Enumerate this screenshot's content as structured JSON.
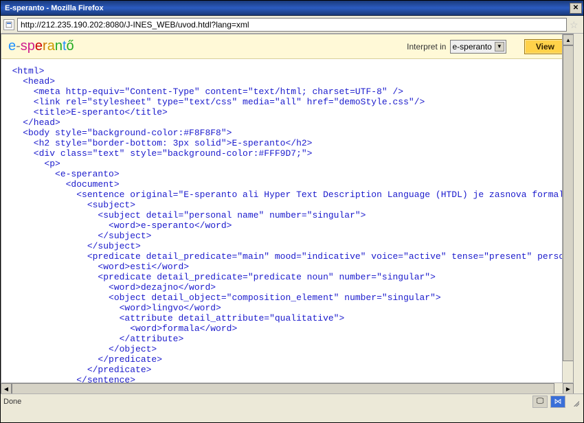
{
  "window": {
    "title": "E-speranto - Mozilla Firefox",
    "close_symbol": "✕"
  },
  "address_bar": {
    "url": "http://212.235.190.202:8080/J-INES_WEB/uvod.htdl?lang=xml",
    "star_symbol": "☆"
  },
  "banner": {
    "logo_parts": [
      {
        "text": "e",
        "color": "#1e90ff"
      },
      {
        "text": "-",
        "color": "#888888"
      },
      {
        "text": "s",
        "color": "#d02090"
      },
      {
        "text": "p",
        "color": "#d02090"
      },
      {
        "text": "e",
        "color": "#cc0000"
      },
      {
        "text": "r",
        "color": "#cc7700"
      },
      {
        "text": "a",
        "color": "#cc9900"
      },
      {
        "text": "n",
        "color": "#22aa22"
      },
      {
        "text": "t",
        "color": "#1e90ff"
      },
      {
        "text": "ő",
        "color": "#22aa22"
      }
    ],
    "interpret_label": "Interpret in",
    "select_value": "e-speranto",
    "view_label": "View"
  },
  "code_lines": [
    "  <html>",
    "    <head>",
    "      <meta http-equiv=\"Content-Type\" content=\"text/html; charset=UTF-8\" />",
    "      <link rel=\"stylesheet\" type=\"text/css\" media=\"all\" href=\"demoStyle.css\"/>",
    "      <title>E-speranto</title>",
    "    </head>",
    "    <body style=\"background-color:#F8F8F8\">",
    "      <h2 style=\"border-bottom: 3px solid\">E-speranto</h2>",
    "      <div class=\"text\" style=\"background-color:#FFF9D7;\">",
    "        <p>",
    "          <e-speranto>",
    "            <document>",
    "              <sentence original=\"E-speranto ali Hyper Text Description Language (HTDL) je zasnova formalnega",
    "                <subject>",
    "                  <subject detail=\"personal name\" number=\"singular\">",
    "                    <word>e-speranto</word>",
    "                  </subject>",
    "                </subject>",
    "                <predicate detail_predicate=\"main\" mood=\"indicative\" voice=\"active\" tense=\"present\" person=\"",
    "                  <word>esti</word>",
    "                  <predicate detail_predicate=\"predicate noun\" number=\"singular\">",
    "                    <word>dezajno</word>",
    "                    <object detail_object=\"composition_element\" number=\"singular\">",
    "                      <word>lingvo</word>",
    "                      <attribute detail_attribute=\"qualitative\">",
    "                        <word>formala</word>",
    "                      </attribute>",
    "                    </object>",
    "                  </predicate>",
    "                </predicate>",
    "              </sentence>"
  ],
  "status": {
    "text": "Done",
    "tray_symbol": "⋈"
  },
  "colors": {
    "banner_bg": "#fff9d7",
    "code_color": "#1a1acc"
  }
}
